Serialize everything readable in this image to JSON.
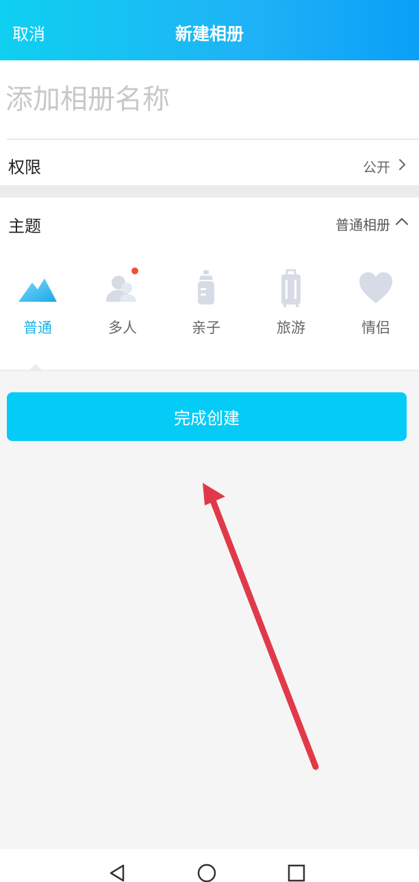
{
  "header": {
    "cancel_label": "取消",
    "title": "新建相册"
  },
  "album_name": {
    "placeholder": "添加相册名称",
    "value": ""
  },
  "permission": {
    "label": "权限",
    "value": "公开",
    "icon": "chevron-right-icon"
  },
  "theme": {
    "label": "主题",
    "value": "普通相册",
    "icon": "chevron-up-icon",
    "items": [
      {
        "label": "普通",
        "icon": "mountain-icon",
        "active": true
      },
      {
        "label": "多人",
        "icon": "people-icon",
        "badge": true
      },
      {
        "label": "亲子",
        "icon": "baby-bottle-icon"
      },
      {
        "label": "旅游",
        "icon": "luggage-icon"
      },
      {
        "label": "情侣",
        "icon": "heart-icon"
      }
    ]
  },
  "create_button": {
    "label": "完成创建"
  },
  "colors": {
    "accent": "#1cb0e8",
    "button": "#05ccf6",
    "annotation_arrow": "#e03a4a",
    "badge": "#f05032",
    "icon_inactive": "#d6dbe6"
  },
  "navbar": {
    "icons": [
      "back-triangle-icon",
      "home-circle-icon",
      "recent-square-icon"
    ]
  }
}
